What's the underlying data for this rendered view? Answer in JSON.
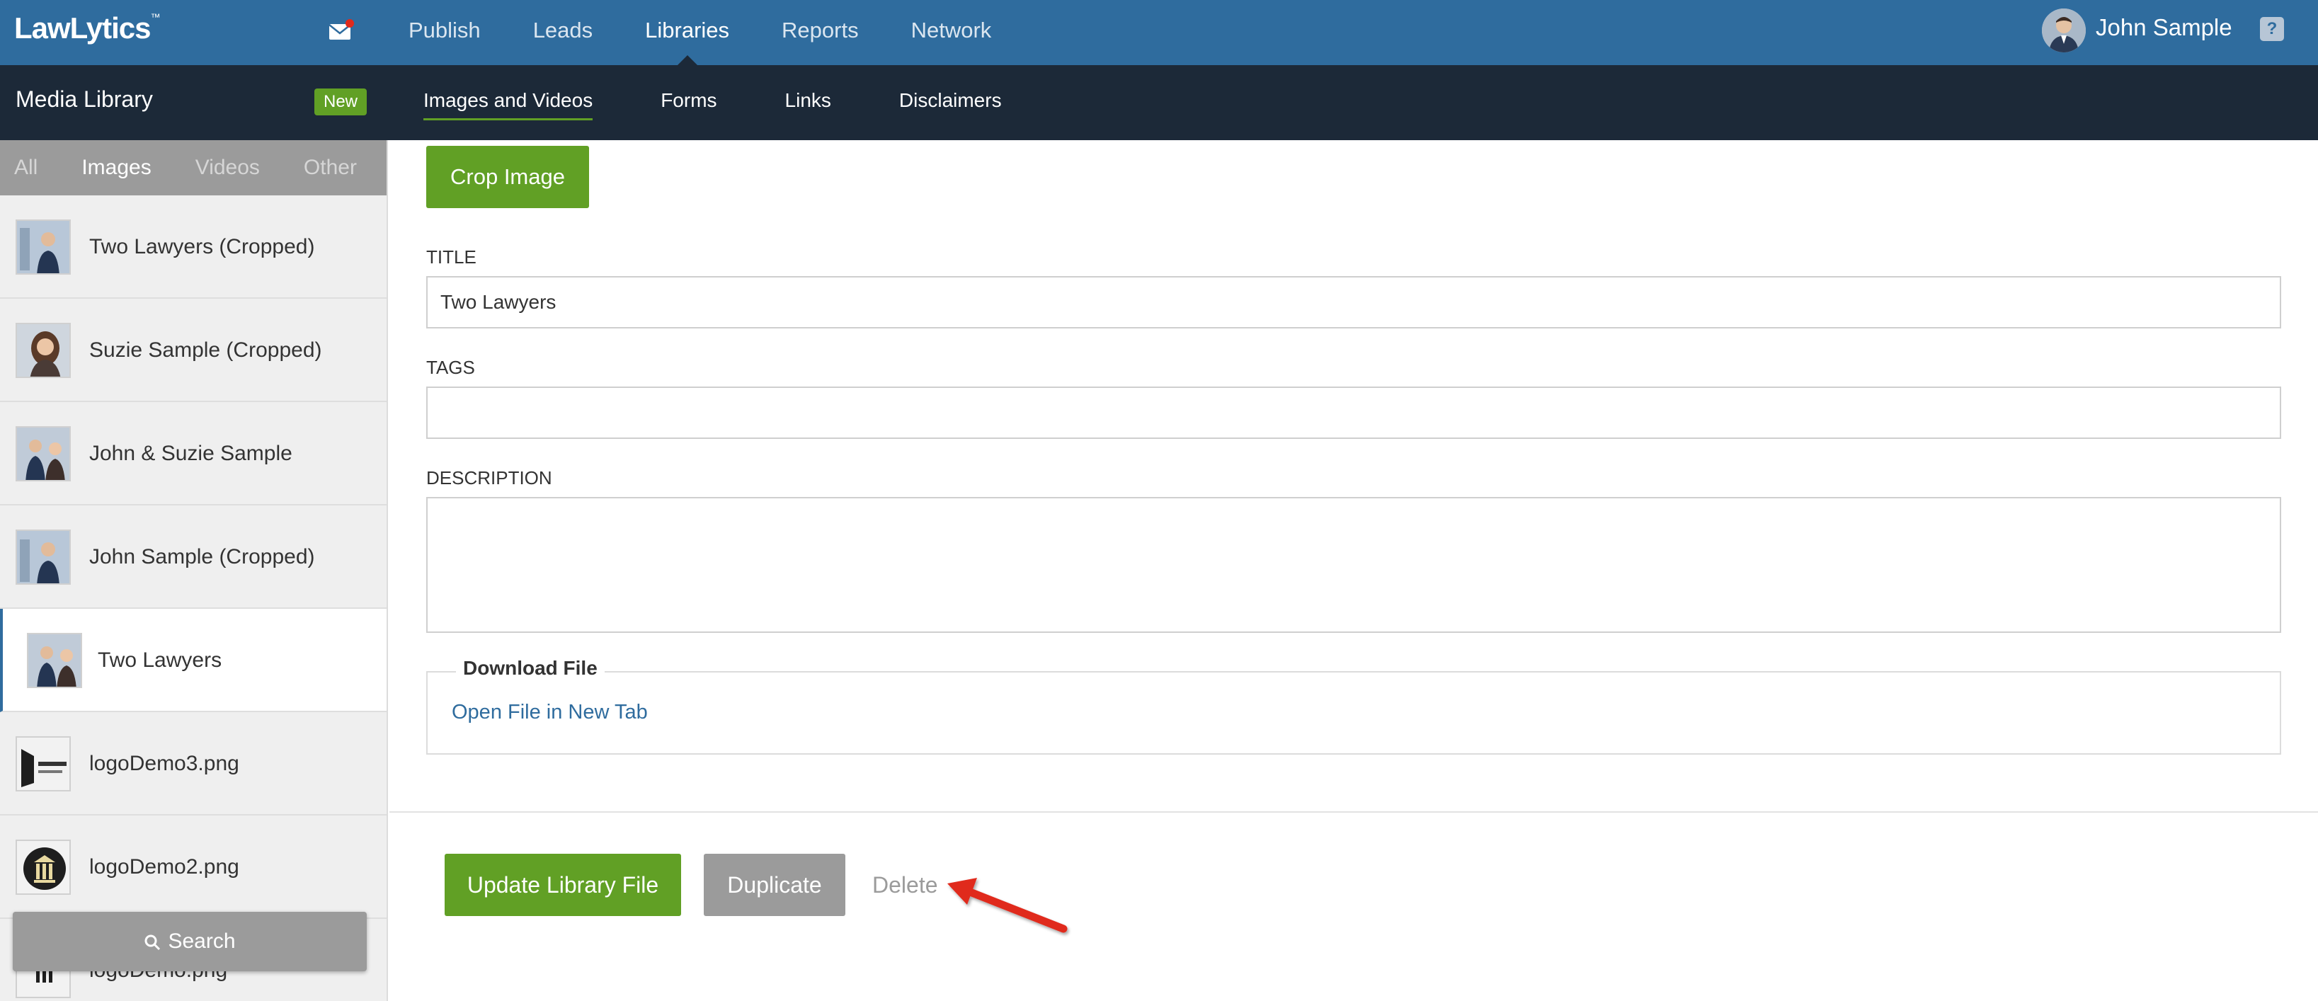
{
  "top_nav": {
    "logo": "LawLytics",
    "logo_tm": "™",
    "items": [
      "Publish",
      "Leads",
      "Libraries",
      "Reports",
      "Network"
    ],
    "active": "Libraries",
    "user_name": "John Sample",
    "help": "?"
  },
  "sub_nav": {
    "title": "Media Library",
    "badge": "New",
    "items": [
      "Images and Videos",
      "Forms",
      "Links",
      "Disclaimers"
    ],
    "active": "Images and Videos"
  },
  "sidebar": {
    "filters": [
      "All",
      "Images",
      "Videos",
      "Other"
    ],
    "active_filter": "Images",
    "items": [
      {
        "label": "Two Lawyers (Cropped)"
      },
      {
        "label": "Suzie Sample (Cropped)"
      },
      {
        "label": "John & Suzie Sample"
      },
      {
        "label": "John Sample (Cropped)"
      },
      {
        "label": "Two Lawyers"
      },
      {
        "label": "logoDemo3.png"
      },
      {
        "label": "logoDemo2.png"
      },
      {
        "label": "logoDemo.png"
      }
    ],
    "active_item": "Two Lawyers",
    "search_label": "Search"
  },
  "main": {
    "crop_label": "Crop Image",
    "title_label": "TITLE",
    "title_value": "Two Lawyers",
    "tags_label": "TAGS",
    "tags_value": "",
    "description_label": "DESCRIPTION",
    "description_value": "",
    "download_title": "Download File",
    "download_link": "Open File in New Tab",
    "update_label": "Update Library File",
    "duplicate_label": "Duplicate",
    "delete_label": "Delete"
  },
  "colors": {
    "topbar": "#2f6c9e",
    "subbar": "#1c2938",
    "accent_green": "#61a025",
    "annotation_arrow": "#e0291b"
  }
}
